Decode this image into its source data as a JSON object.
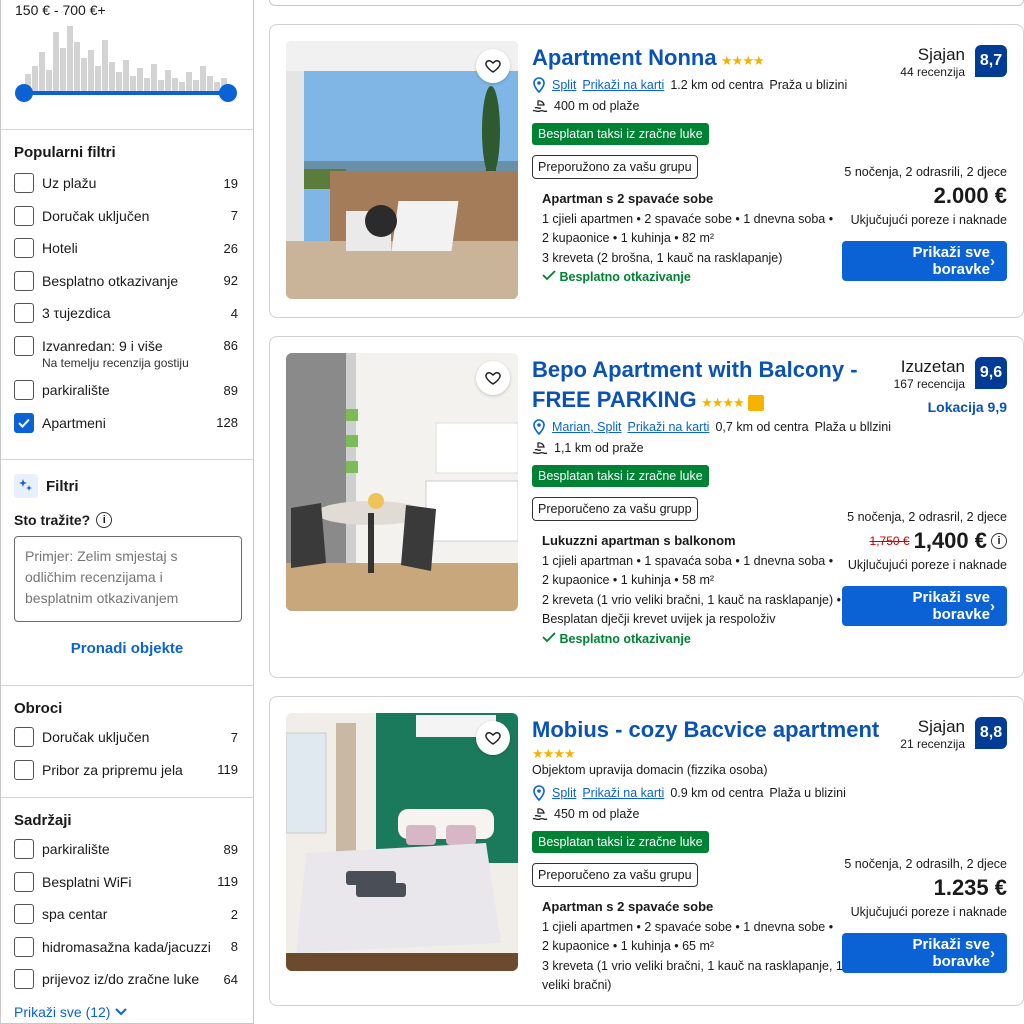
{
  "sidebar": {
    "price_range": "150 € - 700 €+",
    "popular": {
      "title": "Popularni filtri",
      "items": [
        {
          "label": "Uz plažu",
          "count": "19",
          "checked": false
        },
        {
          "label": "Doručak uključen",
          "count": "7",
          "checked": false
        },
        {
          "label": "Hoteli",
          "count": "26",
          "checked": false
        },
        {
          "label": "Besplatno otkazivanje",
          "count": "92",
          "checked": false
        },
        {
          "label": "3 τujezdica",
          "count": "4",
          "checked": false
        },
        {
          "label": "Izvanredan: 9 i više",
          "count": "86",
          "checked": false,
          "sub": "Na temelju recenzija gostiju"
        },
        {
          "label": "parkiralište",
          "count": "89",
          "checked": false
        },
        {
          "label": "Apartmeni",
          "count": "128",
          "checked": true
        }
      ]
    },
    "ai": {
      "title": "Filtri",
      "question": "Sto tražite?",
      "placeholder": "Primjer: Zelim smjestaj s odličhim recenzijama i besplatnim otkazivanjem",
      "find": "Pronadi objekte"
    },
    "meals": {
      "title": "Obroci",
      "items": [
        {
          "label": "Doručak uključen",
          "count": "7"
        },
        {
          "label": "Pribor za pripremu jela",
          "count": "119"
        }
      ]
    },
    "facilities": {
      "title": "Sadržaji",
      "items": [
        {
          "label": "parkiralište",
          "count": "89"
        },
        {
          "label": "Besplatni WiFi",
          "count": "119"
        },
        {
          "label": "spa centar",
          "count": "2"
        },
        {
          "label": "hidromasažna kada/jacuzzi",
          "count": "8"
        },
        {
          "label": "prijevoz iz/do zračne luke",
          "count": "64"
        }
      ],
      "show_all": "Prikaži sve (12)"
    }
  },
  "listings": [
    {
      "title": "Apartment Nonna",
      "stars": "★★★★",
      "city": "Split",
      "map": "Prikaži na karti",
      "dist": "1.2 km od centra",
      "beach_near": "Praža u blizini",
      "beach": "400 m od plaže",
      "taxi": "Besplatan taksi iz zračne luke",
      "rec": "Preporužono za vašu grupu",
      "room_title": "Apartman s 2 spavaće sobe",
      "room_lines": [
        "1 cjieli apartmen • 2 spavaće sobe • 1 dnevna soba •",
        "2 kupaonice • 1 kuhinja • 82 m²",
        "3 kreveta (2 brošna, 1 kauč na rasklapanje)"
      ],
      "free": "Besplatno otkazivanje",
      "rating_word": "Sjajan",
      "reviews": "44 recenzija",
      "score": "8,7",
      "nights": "5 nočenja, 2 odrasrili, 2 djece",
      "price": "2.000 €",
      "tax": "Ukjučujući poreze i naknade",
      "btn": "Prikaži sve boravke"
    },
    {
      "title": "Bepo Apartment with Balcony - FREE PARKING",
      "stars": "★★★★",
      "city": "Marian, Split",
      "map": "Prikaži na karti",
      "dist": "0,7 km od centra",
      "beach_near": "Plaža u bllzini",
      "beach": "1,1 km od praže",
      "taxi": "Besplatan taksi iz zračne luke",
      "rec": "Preporučeno za vašu grupp",
      "room_title": "Lukuzzni apartman s balkonom",
      "room_lines": [
        "1 cjieli apartman • 1 spavaća soba • 1 dnevna soba •",
        "2 kupaonice • 1 kuhinja • 58 m²",
        "2 kreveta (1 vrio veliki bračni, 1 kauč na rasklapanje) •",
        "Besplatan dječji krevet uvijek ja respoloživ"
      ],
      "free": "Besplatno otkazivanje",
      "rating_word": "Izuzetan",
      "reviews": "167 recencija",
      "score": "9,6",
      "location": "Lokacija 9,9",
      "nights": "5 nočenja, 2 odrasril, 2 djece",
      "old_price": "1,750 €",
      "price": "1,400 €",
      "tax": "Ukjlučujući poreze i naknade",
      "btn": "Prikaži sve boravke"
    },
    {
      "title": "Mobius - cozy Bacvice apartment",
      "stars": "★★★★",
      "managed": "Objektom upravija domacin (fizzika osoba)",
      "city": "Split",
      "map": "Prikaži na karti",
      "dist": "0.9 km od centra",
      "beach_near": "Plaža u blizini",
      "beach": "450 m od plaže",
      "taxi": "Besplatan taksi iz zračne luke",
      "rec": "Preporučeno za vašu grupu",
      "room_title": "Apartman s 2 spavaće sobe",
      "room_lines": [
        "1 cjieli apartmen • 2 spavaće sobe • 1 dnevna sobe •",
        "2 kupaonice • 1 kuhinja • 65 m²",
        "3 kreveta (1 vrio veliki bračni, 1 kauč na rasklapanje, 1",
        "veliki bračni)"
      ],
      "rating_word": "Sjajan",
      "reviews": "21 recenzija",
      "score": "8,8",
      "nights": "5 nočenja, 2 odrasilh, 2 djece",
      "price": "1.235 €",
      "tax": "Ukjučujući poreze i naknade",
      "btn": "Prikaži sve boravke"
    }
  ]
}
